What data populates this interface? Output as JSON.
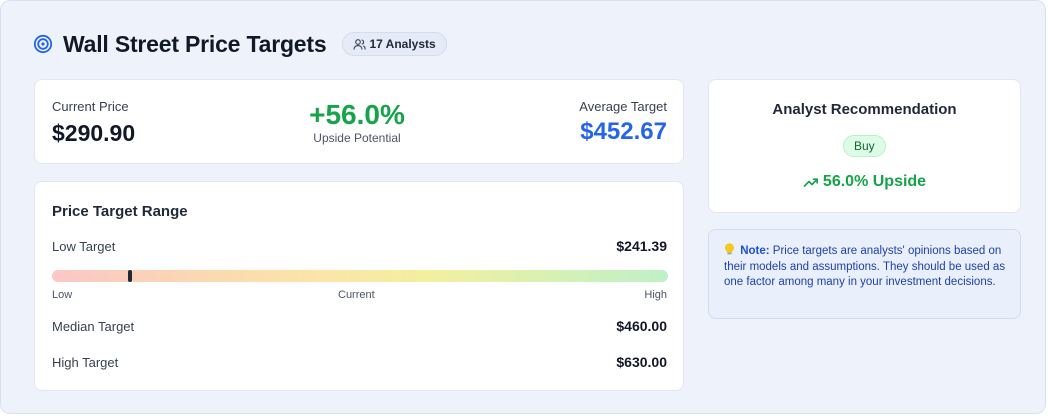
{
  "header": {
    "title": "Wall Street Price Targets",
    "analysts_badge": "17 Analysts",
    "icons": {
      "title_icon": "target-icon",
      "badge_icon": "users-icon"
    }
  },
  "price_summary": {
    "current_label": "Current Price",
    "current_value": "$290.90",
    "upside_value": "+56.0%",
    "upside_label": "Upside Potential",
    "average_label": "Average Target",
    "average_value": "$452.67"
  },
  "range": {
    "title": "Price Target Range",
    "low_label": "Low Target",
    "low_value": "$241.39",
    "scale_low": "Low",
    "scale_current": "Current",
    "scale_high": "High",
    "current_marker_fraction": 0.127,
    "median_label": "Median Target",
    "median_value": "$460.00",
    "high_label": "High Target",
    "high_value": "$630.00"
  },
  "recommendation": {
    "title": "Analyst Recommendation",
    "badge": "Buy",
    "upside_text": "56.0% Upside",
    "icon": "trending-up-icon"
  },
  "note": {
    "icon": "lightbulb-icon",
    "label": "Note:",
    "text": "Price targets are analysts' opinions based on their models and assumptions. They should be used as one factor among many in your investment decisions."
  },
  "colors": {
    "accent_blue": "#2563eb",
    "positive_green": "#16a34a",
    "panel_bg": "#eef3fb",
    "note_text": "#1e40af"
  }
}
